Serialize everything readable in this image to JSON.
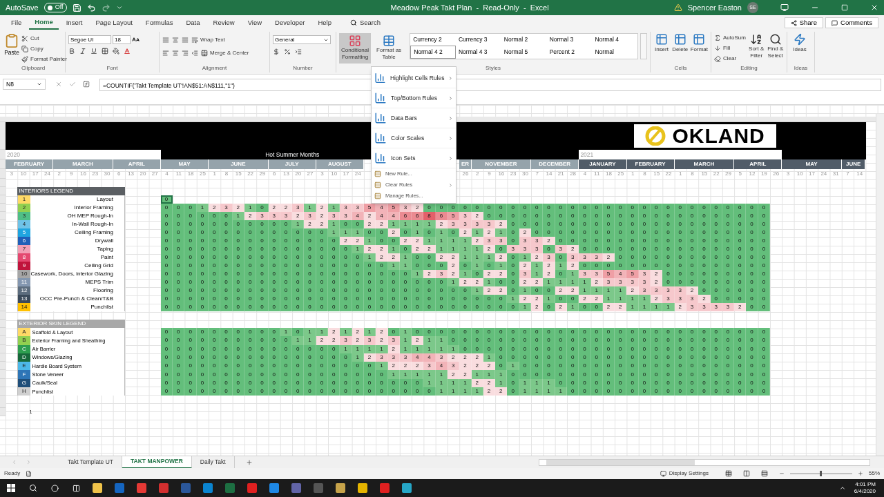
{
  "title_bar": {
    "autosave": "AutoSave",
    "autosave_on": false,
    "autosave_state": "Off",
    "title": "Meadow Peak Takt Plan  -  Read-Only  -  Excel",
    "user": "Spencer Easton",
    "initials": "SE"
  },
  "tabs": [
    {
      "label": "File",
      "selected": false
    },
    {
      "label": "Home",
      "selected": true
    },
    {
      "label": "Insert",
      "selected": false
    },
    {
      "label": "Page Layout",
      "selected": false
    },
    {
      "label": "Formulas",
      "selected": false
    },
    {
      "label": "Data",
      "selected": false
    },
    {
      "label": "Review",
      "selected": false
    },
    {
      "label": "View",
      "selected": false
    },
    {
      "label": "Developer",
      "selected": false
    },
    {
      "label": "Help",
      "selected": false
    }
  ],
  "search": {
    "placeholder": "Search"
  },
  "share": "Share",
  "comments": "Comments",
  "ribbon": [
    {
      "kind": "clipboard",
      "label": "Clipboard",
      "paste": "Paste",
      "items": [
        "Cut",
        "Copy",
        "Format Painter"
      ]
    },
    {
      "kind": "font",
      "label": "Font",
      "font": "Segoe UI",
      "size": "18"
    },
    {
      "kind": "alignment",
      "label": "Alignment",
      "wrap": "Wrap Text",
      "merge": "Merge & Center"
    },
    {
      "kind": "number",
      "label": "Number",
      "format": "General"
    },
    {
      "kind": "styles",
      "label": "Styles",
      "buttons": [
        {
          "text": "Conditional Formatting",
          "pressed": true
        },
        {
          "text": "Format as Table",
          "pressed": false
        }
      ],
      "gallery": [
        {
          "text": "Currency 2",
          "selected": false
        },
        {
          "text": "Currency 3",
          "selected": false
        },
        {
          "text": "Normal 2",
          "selected": false
        },
        {
          "text": "Normal 3",
          "selected": false
        },
        {
          "text": "Normal 4",
          "selected": false
        },
        {
          "text": "Normal 4 2",
          "selected": true
        },
        {
          "text": "Normal 4 3",
          "selected": false
        },
        {
          "text": "Normal 5",
          "selected": false
        },
        {
          "text": "Percent 2",
          "selected": false
        },
        {
          "text": "Normal",
          "selected": false
        }
      ]
    },
    {
      "kind": "cells",
      "label": "Cells",
      "buttons": [
        "Insert",
        "Delete",
        "Format"
      ]
    },
    {
      "kind": "editing",
      "label": "Editing",
      "items": [
        "AutoSum",
        "Fill",
        "Clear"
      ],
      "buttons": [
        "Sort & Filter",
        "Find & Select"
      ]
    },
    {
      "kind": "ideas",
      "label": "Ideas",
      "buttons": [
        "Ideas"
      ]
    }
  ],
  "formula_bar": {
    "name_box": "N8",
    "formula": "=COUNTIF('Takt Template UT'!AN$51:AN$111,\"1\")"
  },
  "menu": [
    {
      "label": "Highlight Cells Rules",
      "kind": "large",
      "submenu": true
    },
    {
      "label": "Top/Bottom Rules",
      "kind": "large",
      "submenu": true
    },
    {
      "label": "Data Bars",
      "kind": "large",
      "submenu": true
    },
    {
      "label": "Color Scales",
      "kind": "large",
      "submenu": true
    },
    {
      "label": "Icon Sets",
      "kind": "large",
      "submenu": true
    },
    {
      "label": "New Rule...",
      "kind": "small",
      "submenu": false
    },
    {
      "label": "Clear Rules",
      "kind": "small",
      "submenu": true
    },
    {
      "label": "Manage Rules...",
      "kind": "small",
      "submenu": false
    }
  ],
  "sheet": {
    "logo": "OKLAND",
    "year_band": [
      {
        "kind": "year",
        "text": "2020"
      },
      {
        "kind": "note",
        "text": "Hot Summer Months"
      },
      {
        "kind": "year",
        "text": "2021"
      }
    ],
    "months": [
      {
        "kind": "month",
        "label": "FEBRUARY",
        "color": "#95a3ab",
        "days": [
          "3",
          "10",
          "17",
          "24"
        ]
      },
      {
        "kind": "month",
        "label": "MARCH",
        "color": "#95a3ab",
        "days": [
          "2",
          "9",
          "16",
          "23",
          "30"
        ]
      },
      {
        "kind": "month",
        "label": "APRIL",
        "color": "#95a3ab",
        "days": [
          "6",
          "13",
          "20",
          "27"
        ]
      },
      {
        "kind": "month",
        "label": "MAY",
        "color": "#95a3ab",
        "days": [
          "4",
          "11",
          "18",
          "25"
        ]
      },
      {
        "kind": "month",
        "label": "JUNE",
        "color": "#95a3ab",
        "days": [
          "1",
          "8",
          "15",
          "22",
          "29"
        ]
      },
      {
        "kind": "month",
        "label": "JULY",
        "color": "#95a3ab",
        "days": [
          "6",
          "13",
          "20",
          "27"
        ]
      },
      {
        "kind": "month",
        "label": "AUGUST",
        "color": "#95a3ab",
        "days": [
          "3",
          "10",
          "17",
          "24"
        ]
      },
      {
        "kind": "covered"
      },
      {
        "kind": "month",
        "label": "ER",
        "color": "#95a3ab",
        "days": [
          "26"
        ]
      },
      {
        "kind": "month",
        "label": "NOVEMBER",
        "color": "#95a3ab",
        "days": [
          "2",
          "9",
          "16",
          "23",
          "30"
        ]
      },
      {
        "kind": "month",
        "label": "DECEMBER",
        "color": "#95a3ab",
        "days": [
          "7",
          "14",
          "21",
          "28"
        ]
      },
      {
        "kind": "month",
        "label": "JANUARY",
        "color": "#515c68",
        "days": [
          "4",
          "11",
          "18",
          "25"
        ]
      },
      {
        "kind": "month",
        "label": "FEBRUARY",
        "color": "#515c68",
        "days": [
          "1",
          "8",
          "15",
          "22"
        ]
      },
      {
        "kind": "month",
        "label": "MARCH",
        "color": "#515c68",
        "days": [
          "1",
          "8",
          "15",
          "22",
          "29"
        ]
      },
      {
        "kind": "month",
        "label": "APRIL",
        "color": "#515c68",
        "days": [
          "5",
          "12",
          "19",
          "26"
        ]
      },
      {
        "kind": "month",
        "label": "MAY",
        "color": "#515c68",
        "days": [
          "3",
          "10",
          "17",
          "24",
          "31"
        ]
      },
      {
        "kind": "month",
        "label": "JUNE",
        "color": "#515c68",
        "days": [
          "7",
          "14"
        ]
      }
    ],
    "interiors": {
      "title": "INTERIORS LEGEND",
      "rows": [
        {
          "badge": "1",
          "label": "Layout",
          "color": "#ffd966",
          "active": true,
          "cells": [
            "0"
          ]
        },
        {
          "badge": "2",
          "label": "Interior Framing",
          "color": "#92d050",
          "active": false,
          "cells": [
            "0",
            "0",
            "0",
            "1",
            "2",
            "3",
            "2",
            "1",
            "0",
            "2",
            "2",
            "3",
            "1",
            "2",
            "1",
            "3",
            "3",
            "5",
            "4",
            "5",
            "3",
            "2",
            "0",
            "0",
            "0",
            "0",
            "0",
            "0",
            "0",
            "0",
            "0",
            "0",
            "0",
            "0",
            "0",
            "0",
            "0",
            "0",
            "0",
            "0",
            "0",
            "0",
            "0",
            "0",
            "0",
            "0",
            "0",
            "0",
            "0",
            "0",
            "0"
          ]
        },
        {
          "badge": "3",
          "label": "OH MEP Rough-In",
          "color": "#4fbf86",
          "active": false,
          "cells": [
            "0",
            "0",
            "0",
            "0",
            "0",
            "0",
            "1",
            "2",
            "3",
            "3",
            "3",
            "2",
            "3",
            "2",
            "3",
            "3",
            "4",
            "2",
            "4",
            "4",
            "6",
            "6",
            "8",
            "6",
            "5",
            "3",
            "2",
            "0",
            "0",
            "0",
            "0",
            "0",
            "0",
            "0",
            "0",
            "0",
            "0",
            "0",
            "0",
            "0",
            "0",
            "0",
            "0",
            "0",
            "0",
            "0",
            "0",
            "0",
            "0",
            "0",
            "0"
          ]
        },
        {
          "badge": "4",
          "label": "In-Wall Rough-In",
          "color": "#6fc3e8",
          "active": false,
          "cells": [
            "0",
            "0",
            "0",
            "0",
            "0",
            "0",
            "0",
            "0",
            "0",
            "0",
            "0",
            "1",
            "2",
            "2",
            "1",
            "0",
            "0",
            "2",
            "2",
            "1",
            "1",
            "1",
            "1",
            "2",
            "3",
            "3",
            "3",
            "3",
            "2",
            "0",
            "0",
            "0",
            "0",
            "0",
            "0",
            "0",
            "0",
            "0",
            "0",
            "0",
            "0",
            "0",
            "0",
            "0",
            "0",
            "0",
            "0",
            "0",
            "0",
            "0",
            "0"
          ]
        },
        {
          "badge": "5",
          "label": "Ceiling Framing",
          "color": "#1fa5e0",
          "active": false,
          "cells": [
            "0",
            "0",
            "0",
            "0",
            "0",
            "0",
            "0",
            "0",
            "0",
            "0",
            "0",
            "0",
            "0",
            "0",
            "1",
            "1",
            "1",
            "0",
            "0",
            "2",
            "0",
            "1",
            "0",
            "1",
            "0",
            "2",
            "1",
            "2",
            "1",
            "0",
            "2",
            "0",
            "0",
            "0",
            "0",
            "0",
            "0",
            "0",
            "0",
            "0",
            "0",
            "0",
            "0",
            "0",
            "0",
            "0",
            "0",
            "0",
            "0",
            "0",
            "0"
          ]
        },
        {
          "badge": "6",
          "label": "Drywall",
          "color": "#1f5fb8",
          "active": false,
          "cells": [
            "0",
            "0",
            "0",
            "0",
            "0",
            "0",
            "0",
            "0",
            "0",
            "0",
            "0",
            "0",
            "0",
            "0",
            "0",
            "2",
            "2",
            "1",
            "0",
            "0",
            "2",
            "2",
            "1",
            "1",
            "1",
            "1",
            "2",
            "3",
            "3",
            "0",
            "3",
            "3",
            "2",
            "0",
            "0",
            "0",
            "0",
            "0",
            "0",
            "0",
            "0",
            "0",
            "0",
            "0",
            "0",
            "0",
            "0",
            "0",
            "0",
            "0",
            "0"
          ]
        },
        {
          "badge": "7",
          "label": "Taping",
          "color": "#f19fb5",
          "active": false,
          "cells": [
            "0",
            "0",
            "0",
            "0",
            "0",
            "0",
            "0",
            "0",
            "0",
            "0",
            "0",
            "0",
            "0",
            "0",
            "0",
            "0",
            "1",
            "2",
            "2",
            "1",
            "0",
            "2",
            "2",
            "1",
            "1",
            "1",
            "1",
            "2",
            "0",
            "3",
            "3",
            "3",
            "0",
            "3",
            "2",
            "0",
            "0",
            "0",
            "0",
            "0",
            "0",
            "0",
            "0",
            "0",
            "0",
            "0",
            "0",
            "0",
            "0",
            "0",
            "0"
          ]
        },
        {
          "badge": "8",
          "label": "Paint",
          "color": "#e4476f",
          "active": false,
          "cells": [
            "0",
            "0",
            "0",
            "0",
            "0",
            "0",
            "0",
            "0",
            "0",
            "0",
            "0",
            "0",
            "0",
            "0",
            "0",
            "0",
            "0",
            "1",
            "2",
            "2",
            "1",
            "0",
            "0",
            "2",
            "2",
            "1",
            "1",
            "1",
            "2",
            "0",
            "1",
            "2",
            "3",
            "0",
            "3",
            "3",
            "3",
            "2",
            "0",
            "0",
            "0",
            "0",
            "0",
            "0",
            "0",
            "0",
            "0",
            "0",
            "0",
            "0",
            "0"
          ]
        },
        {
          "badge": "9",
          "label": "Ceiling Grid",
          "color": "#c0143c",
          "active": false,
          "cells": [
            "0",
            "0",
            "0",
            "0",
            "0",
            "0",
            "0",
            "0",
            "0",
            "0",
            "0",
            "0",
            "0",
            "0",
            "0",
            "0",
            "0",
            "0",
            "0",
            "1",
            "1",
            "0",
            "0",
            "0",
            "2",
            "0",
            "1",
            "0",
            "1",
            "0",
            "2",
            "1",
            "2",
            "1",
            "2",
            "0",
            "0",
            "0",
            "0",
            "0",
            "0",
            "0",
            "0",
            "0",
            "0",
            "0",
            "0",
            "0",
            "0",
            "0",
            "0"
          ]
        },
        {
          "badge": "10",
          "label": "Casework, Doors, interior Glazing",
          "color": "#a6a6a6",
          "active": false,
          "cells": [
            "0",
            "0",
            "0",
            "0",
            "0",
            "0",
            "0",
            "0",
            "0",
            "0",
            "0",
            "0",
            "0",
            "0",
            "0",
            "0",
            "0",
            "0",
            "0",
            "0",
            "0",
            "1",
            "2",
            "3",
            "2",
            "1",
            "0",
            "2",
            "2",
            "0",
            "3",
            "1",
            "2",
            "0",
            "1",
            "3",
            "3",
            "5",
            "4",
            "5",
            "3",
            "2",
            "0",
            "0",
            "0",
            "0",
            "0",
            "0",
            "0",
            "0",
            "0"
          ]
        },
        {
          "badge": "11",
          "label": "MEPS Trim",
          "color": "#8497b0",
          "active": false,
          "cells": [
            "0",
            "0",
            "0",
            "0",
            "0",
            "0",
            "0",
            "0",
            "0",
            "0",
            "0",
            "0",
            "0",
            "0",
            "0",
            "0",
            "0",
            "0",
            "0",
            "0",
            "0",
            "0",
            "0",
            "0",
            "1",
            "2",
            "2",
            "1",
            "0",
            "0",
            "2",
            "2",
            "1",
            "1",
            "1",
            "1",
            "2",
            "3",
            "3",
            "3",
            "3",
            "2",
            "0",
            "0",
            "0",
            "0",
            "0",
            "0",
            "0",
            "0",
            "0"
          ]
        },
        {
          "badge": "12",
          "label": "Flooring",
          "color": "#5d6d7e",
          "active": false,
          "cells": [
            "0",
            "0",
            "0",
            "0",
            "0",
            "0",
            "0",
            "0",
            "0",
            "0",
            "0",
            "0",
            "0",
            "0",
            "0",
            "0",
            "0",
            "0",
            "0",
            "0",
            "0",
            "0",
            "0",
            "0",
            "0",
            "0",
            "1",
            "2",
            "2",
            "0",
            "1",
            "0",
            "0",
            "2",
            "2",
            "1",
            "1",
            "1",
            "1",
            "2",
            "3",
            "3",
            "3",
            "3",
            "2",
            "0",
            "0",
            "0",
            "0",
            "0",
            "0"
          ]
        },
        {
          "badge": "13",
          "label": "OCC Pre-Punch & Clean/T&B",
          "color": "#3b4a5a",
          "active": false,
          "cells": [
            "0",
            "0",
            "0",
            "0",
            "0",
            "0",
            "0",
            "0",
            "0",
            "0",
            "0",
            "0",
            "0",
            "0",
            "0",
            "0",
            "0",
            "0",
            "0",
            "0",
            "0",
            "0",
            "0",
            "0",
            "0",
            "0",
            "0",
            "0",
            "0",
            "1",
            "2",
            "2",
            "1",
            "0",
            "0",
            "2",
            "2",
            "1",
            "1",
            "1",
            "1",
            "2",
            "3",
            "3",
            "3",
            "2",
            "0",
            "0",
            "0",
            "0",
            "0"
          ]
        },
        {
          "badge": "14",
          "label": "Punchlist",
          "color": "#ffc000",
          "active": false,
          "cells": [
            "0",
            "0",
            "0",
            "0",
            "0",
            "0",
            "0",
            "0",
            "0",
            "0",
            "0",
            "0",
            "0",
            "0",
            "0",
            "0",
            "0",
            "0",
            "0",
            "0",
            "0",
            "0",
            "0",
            "0",
            "0",
            "0",
            "0",
            "0",
            "0",
            "0",
            "1",
            "2",
            "0",
            "2",
            "1",
            "0",
            "0",
            "2",
            "2",
            "1",
            "1",
            "1",
            "1",
            "2",
            "3",
            "3",
            "3",
            "3",
            "2",
            "0",
            "0"
          ]
        }
      ]
    },
    "exterior": {
      "title": "EXTERIOR SKIN LEGEND",
      "rows": [
        {
          "badge": "A",
          "label": "Scaffold & Layout",
          "color": "#ffd966",
          "cells": [
            "0",
            "0",
            "0",
            "0",
            "0",
            "0",
            "0",
            "0",
            "0",
            "0",
            "1",
            "0",
            "1",
            "1",
            "2",
            "1",
            "2",
            "1",
            "2",
            "0",
            "1",
            "0",
            "0",
            "0",
            "0",
            "0",
            "0",
            "0",
            "0",
            "0",
            "0",
            "0",
            "0",
            "0",
            "0",
            "0",
            "0",
            "0",
            "0",
            "0",
            "0",
            "0",
            "0",
            "0",
            "0",
            "0",
            "0",
            "0",
            "0",
            "0",
            "0"
          ]
        },
        {
          "badge": "B",
          "label": "Exterior Framing and Sheathing",
          "color": "#92d050",
          "cells": [
            "0",
            "0",
            "0",
            "0",
            "0",
            "0",
            "0",
            "0",
            "0",
            "0",
            "0",
            "1",
            "1",
            "2",
            "2",
            "3",
            "2",
            "3",
            "2",
            "3",
            "1",
            "2",
            "1",
            "1",
            "0",
            "0",
            "0",
            "0",
            "0",
            "0",
            "0",
            "0",
            "0",
            "0",
            "0",
            "0",
            "0",
            "0",
            "0",
            "0",
            "0",
            "0",
            "0",
            "0",
            "0",
            "0",
            "0",
            "0",
            "0",
            "0",
            "0"
          ]
        },
        {
          "badge": "C",
          "label": "Air Barrier",
          "color": "#2e9e4f",
          "cells": [
            "0",
            "0",
            "0",
            "0",
            "0",
            "0",
            "0",
            "0",
            "0",
            "0",
            "0",
            "0",
            "0",
            "0",
            "0",
            "1",
            "1",
            "1",
            "1",
            "2",
            "1",
            "1",
            "1",
            "1",
            "1",
            "0",
            "0",
            "0",
            "0",
            "0",
            "0",
            "0",
            "0",
            "0",
            "0",
            "0",
            "0",
            "0",
            "0",
            "0",
            "0",
            "0",
            "0",
            "0",
            "0",
            "0",
            "0",
            "0",
            "0",
            "0",
            "0"
          ]
        },
        {
          "badge": "D",
          "label": "Windows/Glazing",
          "color": "#17683a",
          "cells": [
            "0",
            "0",
            "0",
            "0",
            "0",
            "0",
            "0",
            "0",
            "0",
            "0",
            "0",
            "0",
            "0",
            "0",
            "0",
            "0",
            "1",
            "2",
            "3",
            "3",
            "3",
            "4",
            "4",
            "3",
            "2",
            "2",
            "2",
            "1",
            "0",
            "0",
            "0",
            "0",
            "0",
            "0",
            "0",
            "0",
            "0",
            "0",
            "0",
            "0",
            "0",
            "0",
            "0",
            "0",
            "0",
            "0",
            "0",
            "0",
            "0",
            "0",
            "0"
          ]
        },
        {
          "badge": "E",
          "label": "Hardie Board System",
          "color": "#4db8e8",
          "cells": [
            "0",
            "0",
            "0",
            "0",
            "0",
            "0",
            "0",
            "0",
            "0",
            "0",
            "0",
            "0",
            "0",
            "0",
            "0",
            "0",
            "0",
            "0",
            "1",
            "2",
            "2",
            "2",
            "3",
            "4",
            "3",
            "2",
            "2",
            "2",
            "0",
            "1",
            "0",
            "0",
            "0",
            "0",
            "0",
            "0",
            "0",
            "0",
            "0",
            "0",
            "0",
            "0",
            "0",
            "0",
            "0",
            "0",
            "0",
            "0",
            "0",
            "0",
            "0"
          ]
        },
        {
          "badge": "F",
          "label": "Stone Veneer",
          "color": "#2e75b6",
          "cells": [
            "0",
            "0",
            "0",
            "0",
            "0",
            "0",
            "0",
            "0",
            "0",
            "0",
            "0",
            "0",
            "0",
            "0",
            "0",
            "0",
            "0",
            "0",
            "0",
            "1",
            "1",
            "1",
            "1",
            "1",
            "2",
            "2",
            "1",
            "1",
            "1",
            "0",
            "0",
            "0",
            "0",
            "0",
            "0",
            "0",
            "0",
            "0",
            "0",
            "0",
            "0",
            "0",
            "0",
            "0",
            "0",
            "0",
            "0",
            "0",
            "0",
            "0",
            "0"
          ]
        },
        {
          "badge": "G",
          "label": "Caulk/Seal",
          "color": "#1f4e79",
          "cells": [
            "0",
            "0",
            "0",
            "0",
            "0",
            "0",
            "0",
            "0",
            "0",
            "0",
            "0",
            "0",
            "0",
            "0",
            "0",
            "0",
            "0",
            "0",
            "0",
            "0",
            "0",
            "0",
            "1",
            "1",
            "1",
            "1",
            "2",
            "2",
            "1",
            "0",
            "1",
            "1",
            "1",
            "0",
            "0",
            "0",
            "0",
            "0",
            "0",
            "0",
            "0",
            "0",
            "0",
            "0",
            "0",
            "0",
            "0",
            "0",
            "0",
            "0",
            "0"
          ]
        },
        {
          "badge": "H",
          "label": "Punchlist",
          "color": "#d0d0d0",
          "cells": [
            "0",
            "0",
            "0",
            "0",
            "0",
            "0",
            "0",
            "0",
            "0",
            "0",
            "0",
            "0",
            "0",
            "0",
            "0",
            "0",
            "0",
            "0",
            "0",
            "0",
            "0",
            "0",
            "0",
            "1",
            "1",
            "1",
            "1",
            "2",
            "2",
            "0",
            "1",
            "1",
            "1",
            "1",
            "0",
            "0",
            "0",
            "0",
            "0",
            "0",
            "0",
            "0",
            "0",
            "0",
            "0",
            "0",
            "0",
            "0",
            "0",
            "0",
            "0"
          ]
        }
      ]
    },
    "stray_cell": "1"
  },
  "sheet_tabs": [
    {
      "label": "Takt Template UT",
      "selected": false
    },
    {
      "label": "TAKT MANPOWER",
      "selected": true
    },
    {
      "label": "Daily Takt",
      "selected": false
    }
  ],
  "status_bar": {
    "ready": "Ready",
    "display_settings": "Display Settings",
    "zoom": "55%",
    "zoom_slider": {
      "level": 0.5
    }
  },
  "taskbar": {
    "time": "4:01 PM",
    "date": "6/4/2020"
  }
}
